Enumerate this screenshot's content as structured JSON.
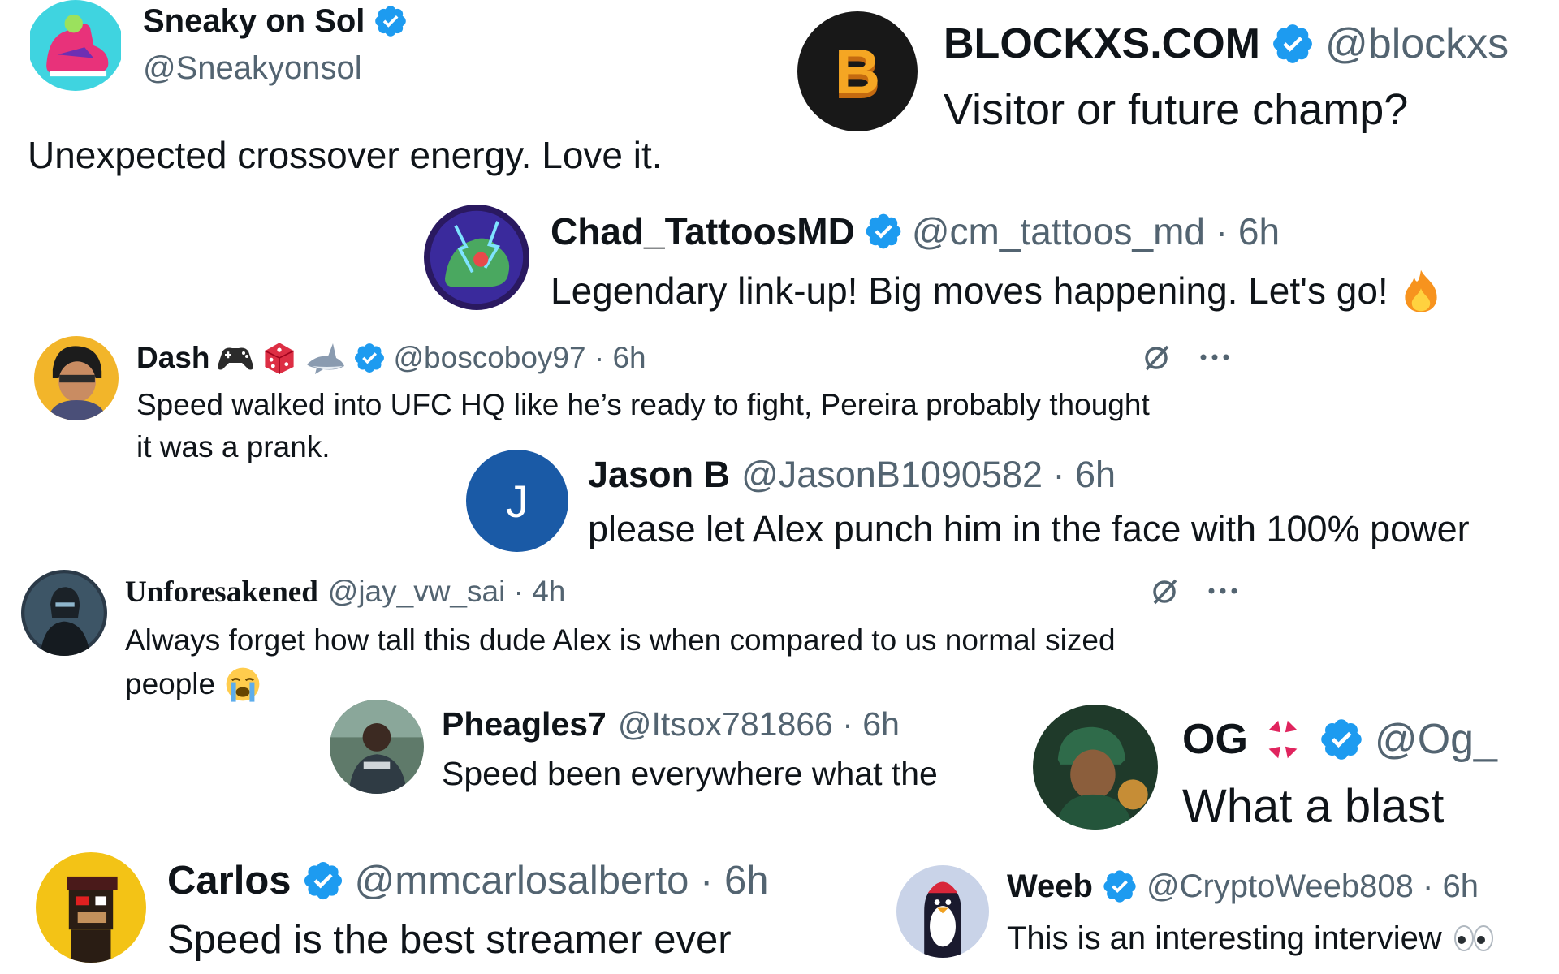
{
  "tweets": {
    "sneaky": {
      "name": "Sneaky on Sol",
      "handle": "@Sneakyonsol",
      "text": "Unexpected crossover energy. Love it."
    },
    "blockxs": {
      "name": "BLOCKXS.COM",
      "handle": "@blockxs",
      "text": "Visitor or future champ?",
      "avatar_letter": "B"
    },
    "chad": {
      "name": "Chad_TattoosMD",
      "handle": "@cm_tattoos_md · 6h",
      "text": "Legendary link-up! Big moves happening. Let's go!"
    },
    "dash": {
      "name": "Dash",
      "handle": "@boscoboy97 · 6h",
      "text_line1": "Speed walked into UFC HQ like he’s ready to fight, Pereira probably thought",
      "text_line2": "it was a prank."
    },
    "jason": {
      "name": "Jason B",
      "handle": "@JasonB1090582 · 6h",
      "text": "please let Alex punch him in the face with 100% power",
      "avatar_letter": "J"
    },
    "unforesakened": {
      "name": "Unforesakened",
      "handle": "@jay_vw_sai · 4h",
      "text_line1": "Always forget how tall this dude Alex is when compared to us normal sized",
      "text_line2": "people"
    },
    "pheagles": {
      "name": "Pheagles7",
      "handle": "@Itsox781866 · 6h",
      "text": "Speed been everywhere what the"
    },
    "og": {
      "name": "OG",
      "handle": "@Og_",
      "text": "What a blast"
    },
    "carlos": {
      "name": "Carlos",
      "handle": "@mmcarlosalberto · 6h",
      "text": "Speed is the best streamer ever"
    },
    "weeb": {
      "name": "Weeb",
      "handle": "@CryptoWeeb808 · 6h",
      "text": "This is an interesting interview"
    }
  },
  "colors": {
    "verified": "#1d9bf0",
    "text": "#0f1419",
    "secondary": "#536471",
    "jason_avatar": "#1a5aa6"
  },
  "icons": [
    "verified-badge-icon",
    "grok-icon",
    "more-icon",
    "fire-emoji",
    "crying-emoji",
    "anger-emoji",
    "eyes-emoji",
    "gamepad-emoji",
    "dice-emoji",
    "shark-emoji"
  ]
}
